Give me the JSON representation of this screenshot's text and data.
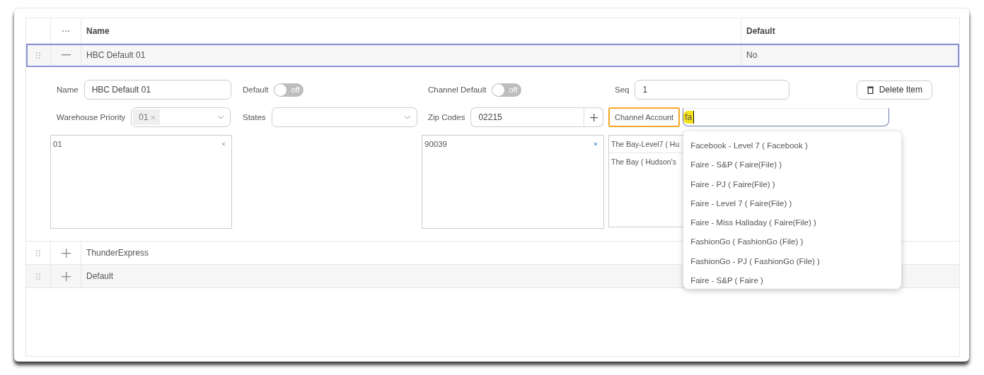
{
  "table": {
    "columns": [
      "Name",
      "Default"
    ],
    "rows": [
      {
        "name": "HBC Default 01",
        "default": "No",
        "expanded": true,
        "selected": true
      },
      {
        "name": "ThunderExpress",
        "expanded": false,
        "selected": false
      },
      {
        "name": "Default",
        "expanded": false,
        "selected": false
      }
    ]
  },
  "detail": {
    "name": {
      "label": "Name",
      "value": "HBC Default 01"
    },
    "default": {
      "label": "Default",
      "on": false,
      "text": "off"
    },
    "channel_default": {
      "label": "Channel Default",
      "on": false,
      "text": "off"
    },
    "seq": {
      "label": "Seq",
      "value": "1"
    },
    "delete_button": "Delete Item",
    "warehouse_priority": {
      "label": "Warehouse Priority",
      "tags": [
        "01"
      ],
      "list": [
        "01"
      ]
    },
    "states": {
      "label": "States"
    },
    "zip_codes": {
      "label": "Zip Codes",
      "value": "02215",
      "list": [
        "90039"
      ]
    },
    "channel_account": {
      "label": "Channel Account",
      "focused": true,
      "value": "fa",
      "list": [
        "The Bay-Level7 ( Hu",
        "The Bay ( Hudson's"
      ]
    },
    "dropdown": {
      "options": [
        "Facebook - Level 7 ( Facebook )",
        "Faire - S&P ( Faire(File) )",
        "Faire - PJ ( Faire(File) )",
        "Faire - Level 7 ( Faire(File) )",
        "Faire - Miss Halladay ( Faire(File) )",
        "FashionGo ( FashionGo (File) )",
        "FashionGo - PJ ( FashionGo (File) )",
        "Faire - S&P ( Faire )"
      ]
    }
  }
}
